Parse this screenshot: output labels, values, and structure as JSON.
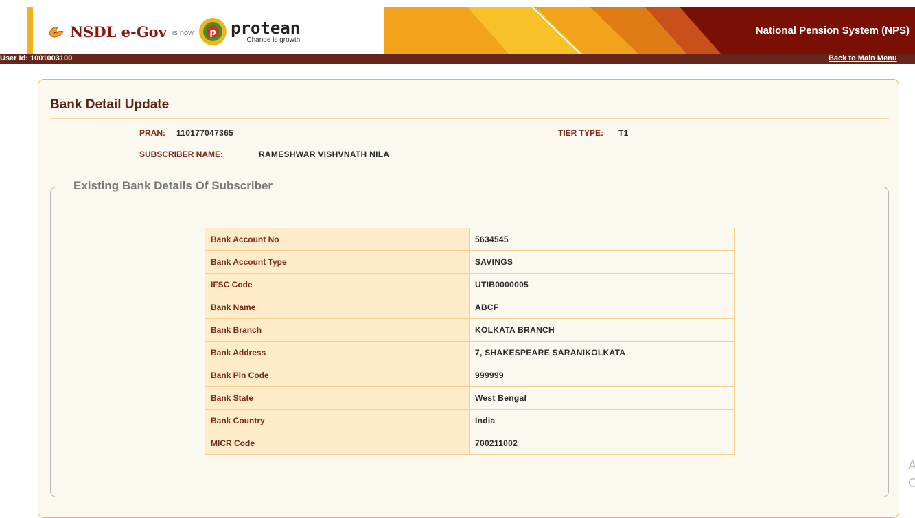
{
  "header": {
    "logo_nsdl": "NSDL e-Gov",
    "logo_isnow": "is now",
    "logo_protean": "protean",
    "logo_tagline": "Change is growth",
    "system_title": "National Pension System (NPS)",
    "user_id": "User Id: 1001003100",
    "back_link": "Back to Main Menu"
  },
  "page": {
    "title": "Bank Detail Update",
    "pran_label": "PRAN:",
    "pran_value": "110177047365",
    "tier_label": "TIER TYPE:",
    "tier_value": "T1",
    "subscriber_label": "SUBSCRIBER NAME:",
    "subscriber_value": "RAMESHWAR VISHVNATH NILA"
  },
  "existing_bank": {
    "legend": "Existing Bank Details Of Subscriber",
    "rows": [
      {
        "label": "Bank Account No",
        "value": "5634545"
      },
      {
        "label": "Bank Account Type",
        "value": "SAVINGS"
      },
      {
        "label": "IFSC Code",
        "value": "UTIB0000005"
      },
      {
        "label": "Bank Name",
        "value": "ABCF"
      },
      {
        "label": "Bank Branch",
        "value": "KOLKATA BRANCH"
      },
      {
        "label": "Bank Address",
        "value": "7, SHAKESPEARE SARANIKOLKATA"
      },
      {
        "label": "Bank Pin Code",
        "value": "999999"
      },
      {
        "label": "Bank State",
        "value": "West Bengal"
      },
      {
        "label": "Bank Country",
        "value": "India"
      },
      {
        "label": "MICR Code",
        "value": "700211002"
      }
    ]
  },
  "colors": {
    "header_maroon": "#7a0f05",
    "userbar_brown": "#66261a",
    "label_text": "#7a2a1a",
    "label_cell_bg": "#fdebc9",
    "panel_bg": "#fbf8ef",
    "panel_border": "#e2b65a"
  },
  "icons": {
    "nsdl": "nsdl-flame-icon",
    "protean": "protean-emblem-icon"
  }
}
